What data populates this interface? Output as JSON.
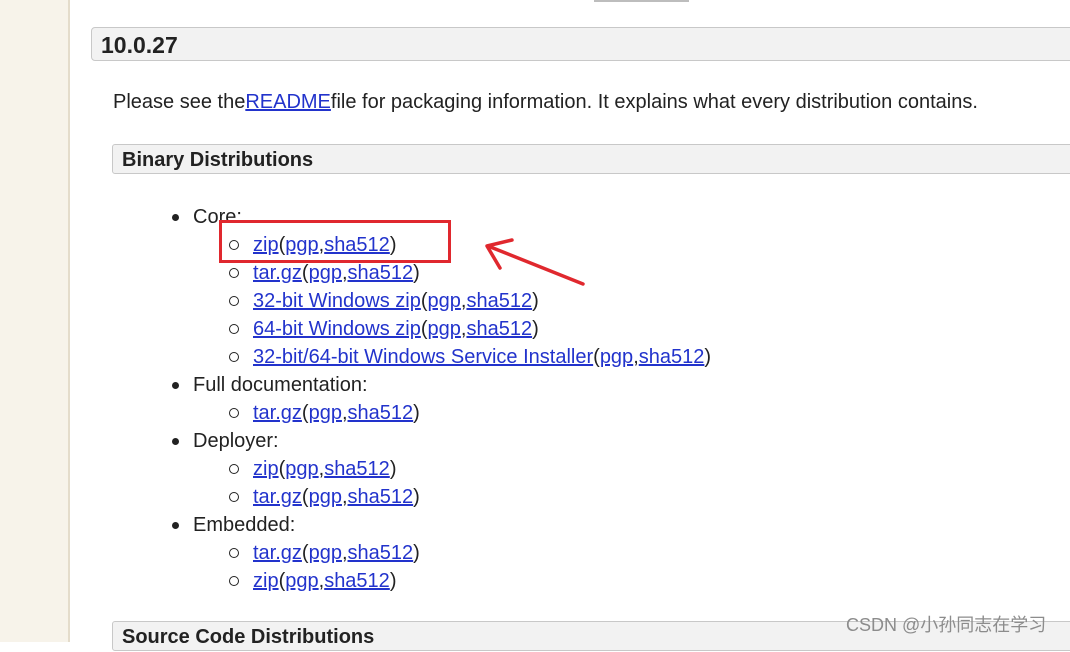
{
  "version_title": "10.0.27",
  "intro": {
    "before": "Please see the",
    "link": "README",
    "after": "file for packaging information. It explains what every distribution contains."
  },
  "binary_header": "Binary Distributions",
  "groups": [
    {
      "label": "Core:",
      "items": [
        {
          "name": "zip",
          "pgp": "pgp",
          "sha": "sha512"
        },
        {
          "name": "tar.gz",
          "pgp": "pgp",
          "sha": "sha512"
        },
        {
          "name": "32-bit Windows zip",
          "pgp": "pgp",
          "sha": "sha512"
        },
        {
          "name": "64-bit Windows zip",
          "pgp": "pgp",
          "sha": "sha512"
        },
        {
          "name": "32-bit/64-bit Windows Service Installer",
          "pgp": "pgp",
          "sha": "sha512"
        }
      ]
    },
    {
      "label": "Full documentation:",
      "items": [
        {
          "name": "tar.gz",
          "pgp": "pgp",
          "sha": "sha512"
        }
      ]
    },
    {
      "label": "Deployer:",
      "items": [
        {
          "name": "zip",
          "pgp": "pgp",
          "sha": "sha512"
        },
        {
          "name": "tar.gz",
          "pgp": "pgp",
          "sha": "sha512"
        }
      ]
    },
    {
      "label": "Embedded:",
      "items": [
        {
          "name": "tar.gz",
          "pgp": "pgp",
          "sha": "sha512"
        },
        {
          "name": "zip",
          "pgp": "pgp",
          "sha": "sha512"
        }
      ]
    }
  ],
  "source_header": "Source Code Distributions",
  "watermark": "CSDN @小孙同志在学习",
  "colors": {
    "link": "#2233cc",
    "annotation": "#e0282e"
  }
}
